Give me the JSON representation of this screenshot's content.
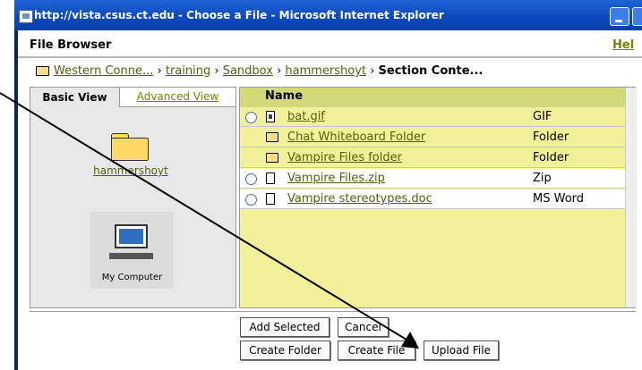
{
  "window": {
    "title": "http://vista.csus.ct.edu - Choose a File - Microsoft Internet Explorer"
  },
  "header": {
    "title": "File Browser",
    "help": "Hel"
  },
  "breadcrumb": {
    "items": [
      "Western Conne...",
      "training",
      "Sandbox",
      "hammershoyt"
    ],
    "separator": "›",
    "current": "Section Conte..."
  },
  "tabs": {
    "basic": "Basic View",
    "advanced": "Advanced View"
  },
  "left_panel": {
    "folder_label": "hammershoyt",
    "computer_label": "My Computer"
  },
  "file_list": {
    "header": "Name",
    "rows": [
      {
        "name": "bat.gif",
        "type": "GIF",
        "icon": "image-file-icon",
        "selectable": true
      },
      {
        "name": "Chat Whiteboard Folder",
        "type": "Folder",
        "icon": "folder-icon",
        "selectable": false
      },
      {
        "name": "Vampire Files folder",
        "type": "Folder",
        "icon": "folder-icon",
        "selectable": false
      },
      {
        "name": "Vampire Files.zip",
        "type": "Zip",
        "icon": "file-icon",
        "selectable": true
      },
      {
        "name": "Vampire stereotypes.doc",
        "type": "MS Word",
        "icon": "file-icon",
        "selectable": true
      }
    ]
  },
  "buttons": {
    "add_selected": "Add Selected",
    "cancel": "Cancel",
    "create_folder": "Create Folder",
    "create_file": "Create File",
    "upload_file": "Upload File"
  },
  "colors": {
    "titlebar": "#0b48bd",
    "list_background": "#f1f19a",
    "link": "#55600a"
  }
}
